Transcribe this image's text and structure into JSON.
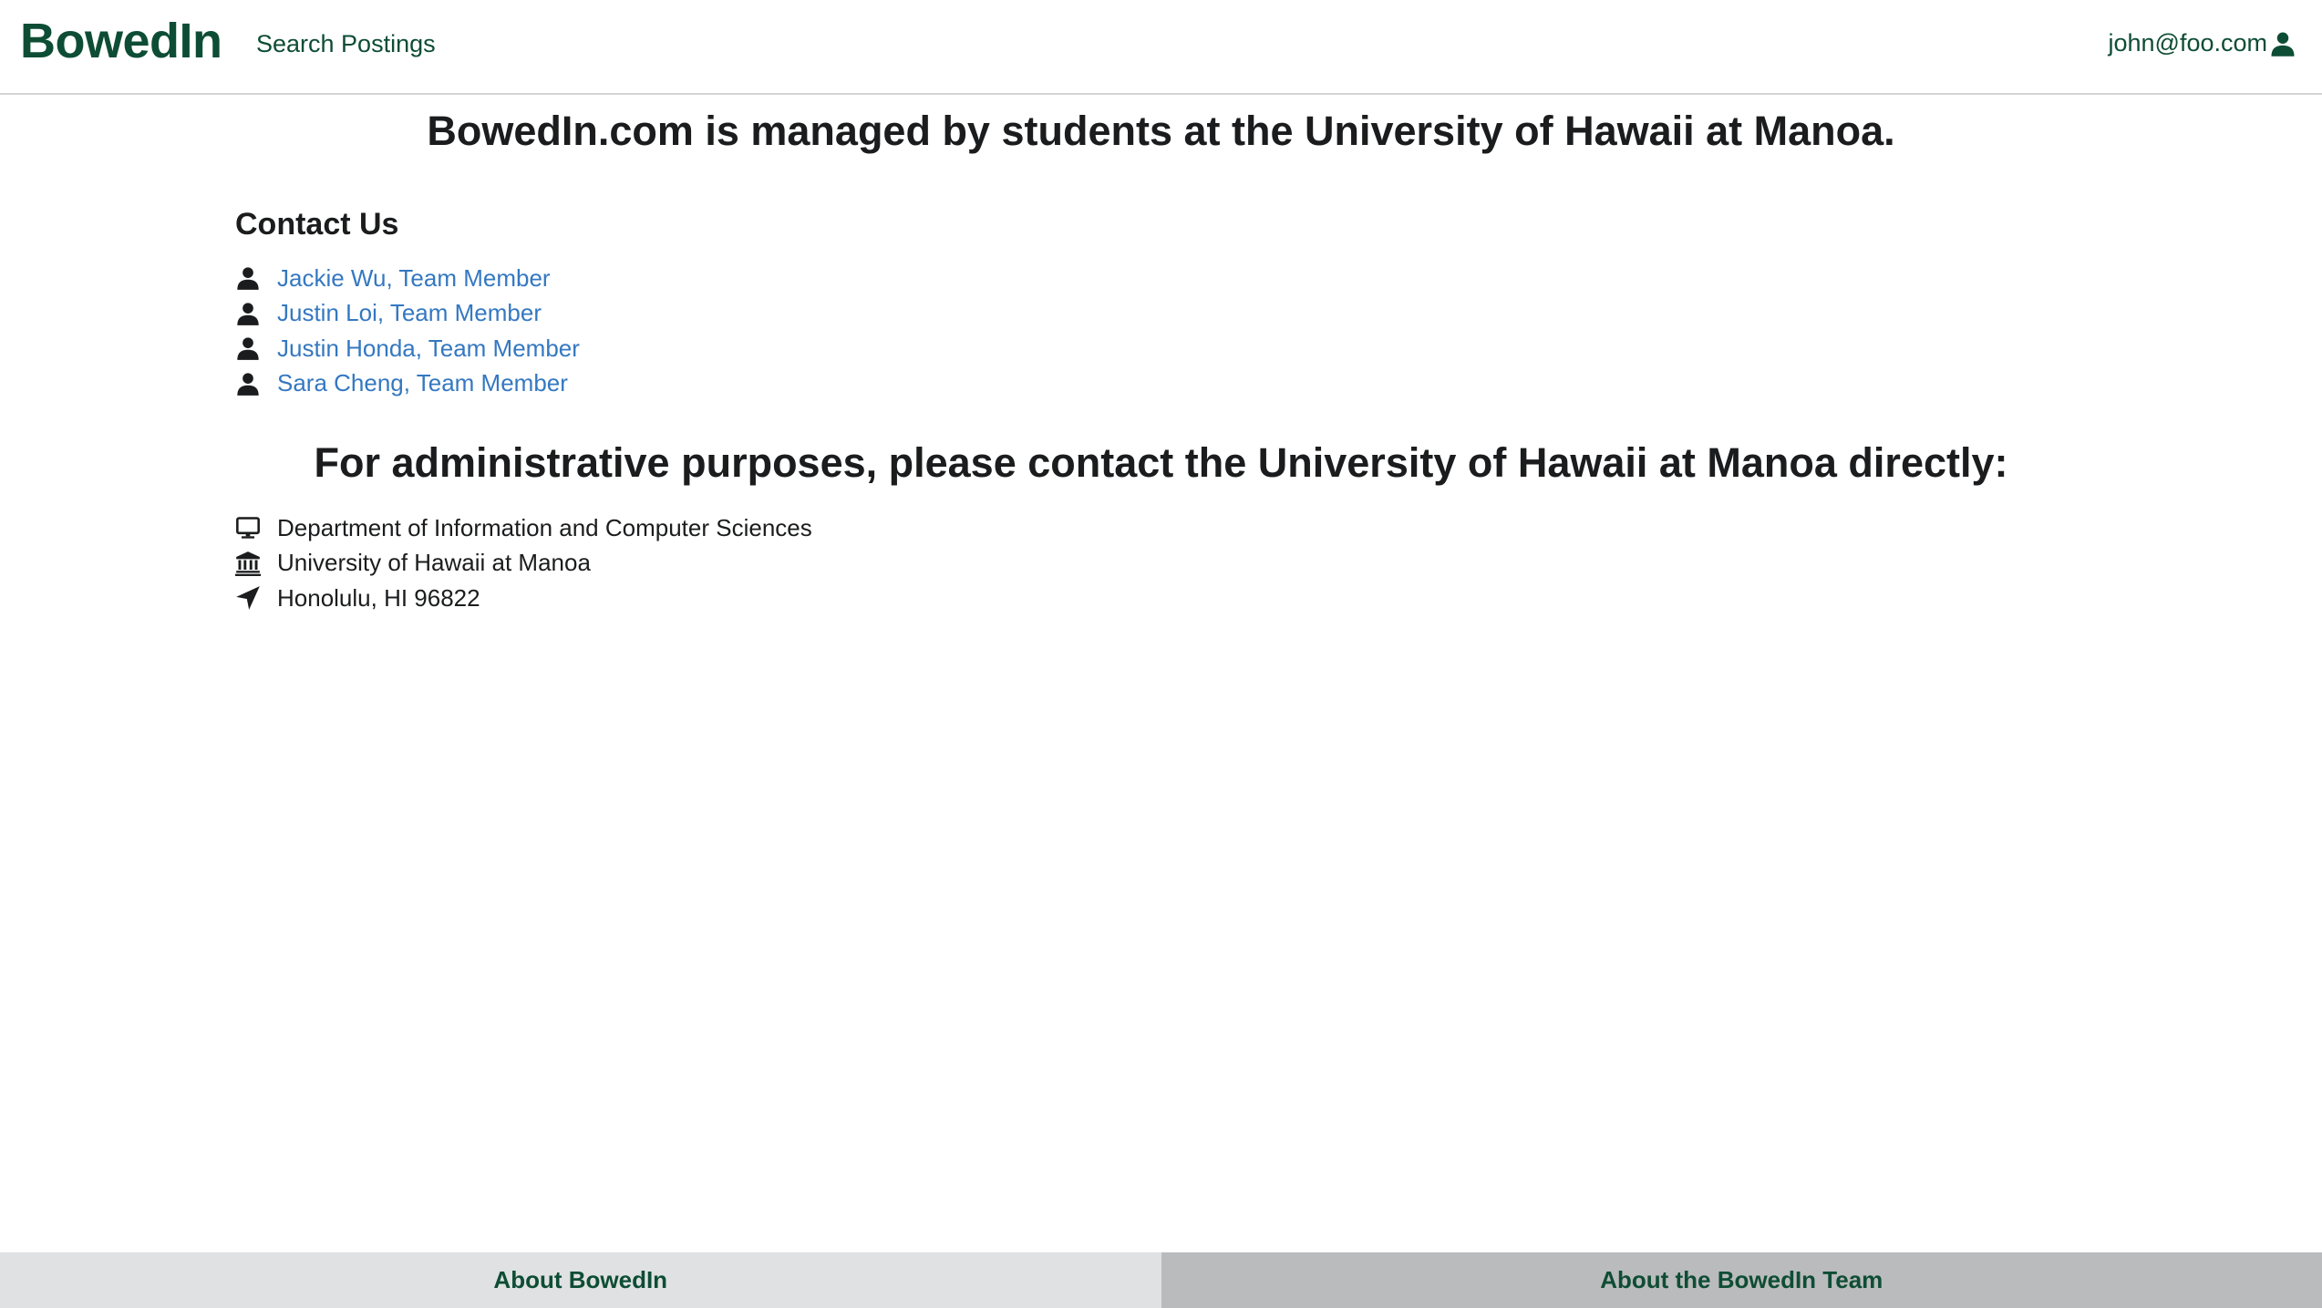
{
  "navbar": {
    "brand": "BowedIn",
    "search_link": "Search Postings",
    "user_email": "john@foo.com",
    "user_icon": "user-icon"
  },
  "main": {
    "heading": "BowedIn.com is managed by students at the University of Hawaii at Manoa.",
    "contact_title": "Contact Us",
    "members": [
      {
        "label": "Jackie Wu, Team Member",
        "icon": "user-icon"
      },
      {
        "label": "Justin Loi, Team Member",
        "icon": "user-icon"
      },
      {
        "label": "Justin Honda, Team Member",
        "icon": "user-icon"
      },
      {
        "label": "Sara Cheng, Team Member",
        "icon": "user-icon"
      }
    ],
    "admin_heading": "For administrative purposes, please contact the University of Hawaii at Manoa directly:",
    "admin_items": [
      {
        "label": "Department of Information and Computer Sciences",
        "icon": "desktop-icon"
      },
      {
        "label": "University of Hawaii at Manoa",
        "icon": "university-icon"
      },
      {
        "label": "Honolulu, HI 96822",
        "icon": "location-arrow-icon"
      }
    ]
  },
  "footer": {
    "left_label": "About BowedIn",
    "right_label": "About the BowedIn Team"
  },
  "colors": {
    "brand_green": "#0e4d35",
    "link_blue": "#3478c1",
    "footer_left_bg": "#e0e1e2",
    "footer_right_bg": "#babbbc"
  }
}
